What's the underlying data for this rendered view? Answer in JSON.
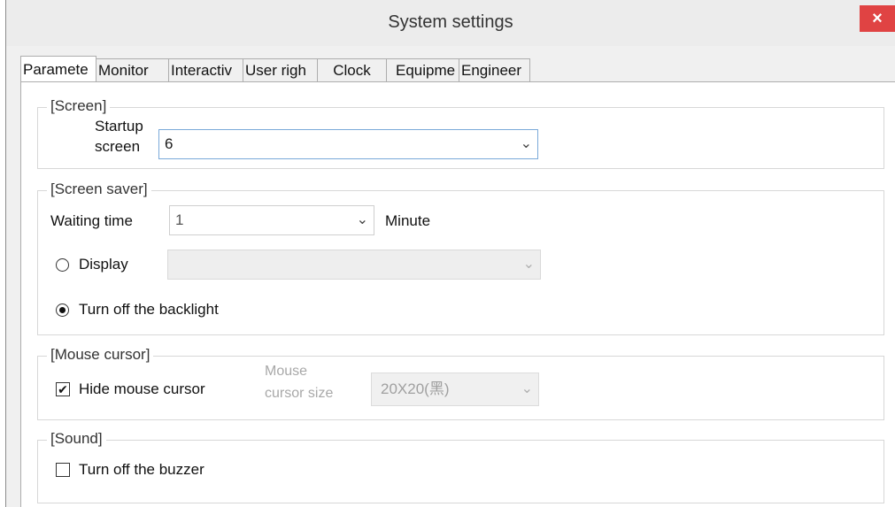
{
  "window": {
    "title": "System settings",
    "close_glyph": "×"
  },
  "tabs": [
    {
      "label": "Paramete"
    },
    {
      "label": "Monitor"
    },
    {
      "label": "Interactiv"
    },
    {
      "label": "User righ"
    },
    {
      "label": "Clock"
    },
    {
      "label": "Equipme"
    },
    {
      "label": "Engineer"
    }
  ],
  "screen": {
    "legend": "[Screen]",
    "startup_label_1": "Startup",
    "startup_label_2": "screen",
    "startup_value": "6"
  },
  "screensaver": {
    "legend": "[Screen saver]",
    "waiting_label": "Waiting time",
    "waiting_value": "1",
    "unit": "Minute",
    "display_label": "Display",
    "display_value": "",
    "backlight_label": "Turn off the backlight",
    "selected_option": "backlight"
  },
  "mouse": {
    "legend": "[Mouse cursor]",
    "hide_label": "Hide mouse cursor",
    "hide_checked": true,
    "size_label_1": "Mouse",
    "size_label_2": "cursor size",
    "size_value": "20X20(黑)"
  },
  "sound": {
    "legend": "[Sound]",
    "buzzer_label": "Turn off the buzzer",
    "buzzer_checked": false
  },
  "icons": {
    "dropdown": "chevron-down-icon",
    "close": "close-icon",
    "check": "checkmark-icon"
  },
  "colors": {
    "close_button": "#e04343",
    "focus_border": "#7aa9d9"
  }
}
